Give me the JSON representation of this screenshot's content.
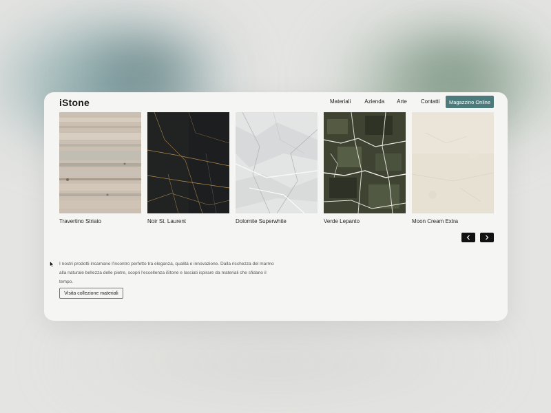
{
  "brand": {
    "logo": "iStone"
  },
  "nav": {
    "items": [
      {
        "label": "Materiali"
      },
      {
        "label": "Azienda"
      },
      {
        "label": "Arte"
      },
      {
        "label": "Contatti"
      }
    ],
    "cta_label": "Magazzino Online"
  },
  "products": [
    {
      "name": "Travertino Striato",
      "color": "#cbbfb2"
    },
    {
      "name": "Noir St. Laurent",
      "color": "#1d1e1f"
    },
    {
      "name": "Dolomite Superwhite",
      "color": "#e3e4e4"
    },
    {
      "name": "Verde Lepanto",
      "color": "#3f4432"
    },
    {
      "name": "Moon Cream Extra",
      "color": "#e6e1d3"
    }
  ],
  "carousel": {
    "prev_icon": "chevron-left-icon",
    "next_icon": "chevron-right-icon"
  },
  "about": {
    "text": "I nostri prodotti incarnano l'incontro perfetto tra eleganza, qualità e innovazione. Dalla ricchezza del marmo alla naturale bellezza delle pietre, scopri l'eccellenza iStone e lasciati ispirare da materiali che sfidano il tempo.",
    "button_label": "Visita collezione materiali"
  },
  "colors": {
    "accent": "#4d7a7a",
    "card_bg": "#f5f5f3",
    "page_bg": "#e4e4e2"
  }
}
